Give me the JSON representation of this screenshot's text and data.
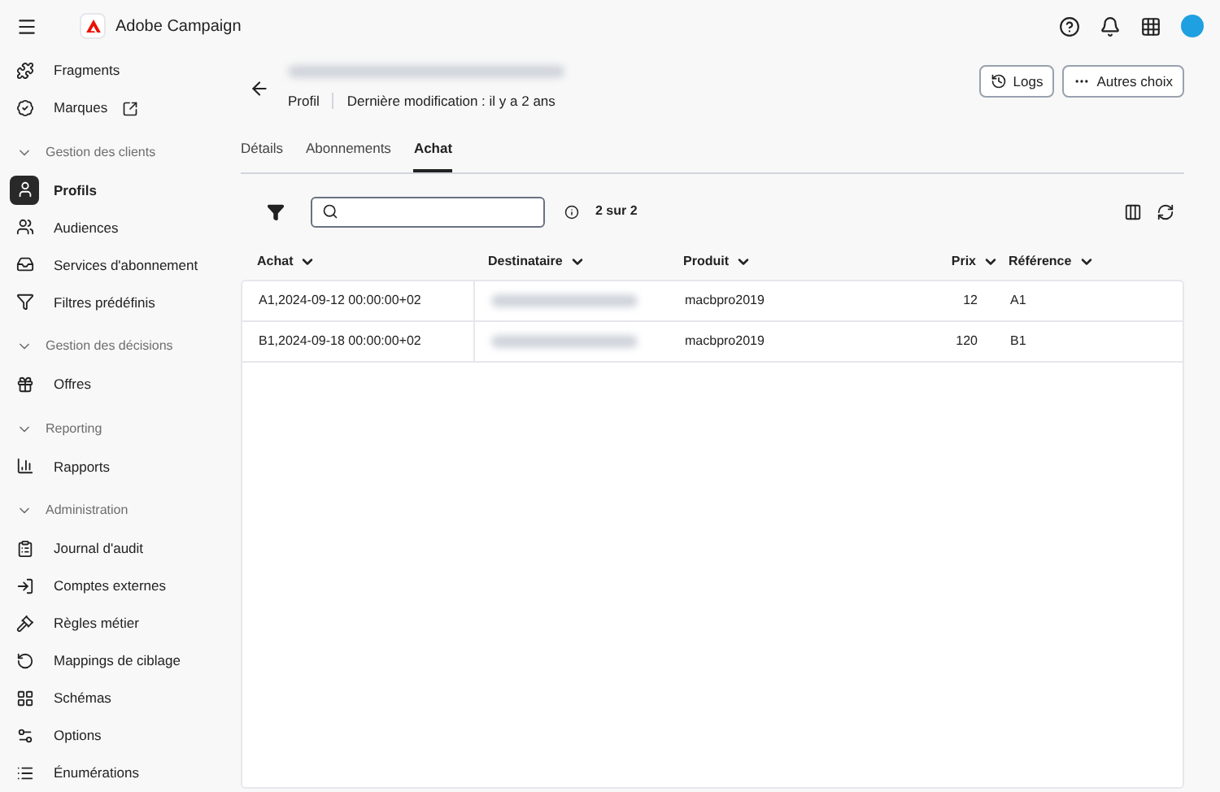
{
  "app": {
    "title": "Adobe Campaign"
  },
  "sidebar": {
    "items": [
      {
        "kind": "item",
        "label": "Fragments",
        "selected": false
      },
      {
        "kind": "item",
        "label": "Marques",
        "selected": false
      },
      {
        "kind": "section",
        "label": "Gestion des clients",
        "expanded": true
      },
      {
        "kind": "item",
        "label": "Profils",
        "selected": true
      },
      {
        "kind": "item",
        "label": "Audiences",
        "selected": false
      },
      {
        "kind": "item",
        "label": "Services d'abonnement",
        "selected": false
      },
      {
        "kind": "item",
        "label": "Filtres prédéfinis",
        "selected": false
      },
      {
        "kind": "section",
        "label": "Gestion des décisions",
        "expanded": true
      },
      {
        "kind": "item",
        "label": "Offres",
        "selected": false
      },
      {
        "kind": "section",
        "label": "Reporting",
        "expanded": true
      },
      {
        "kind": "item",
        "label": "Rapports",
        "selected": false
      },
      {
        "kind": "section",
        "label": "Administration",
        "expanded": true
      },
      {
        "kind": "item",
        "label": "Journal d'audit",
        "selected": false
      },
      {
        "kind": "item",
        "label": "Comptes externes",
        "selected": false
      },
      {
        "kind": "item",
        "label": "Règles métier",
        "selected": false
      },
      {
        "kind": "item",
        "label": "Mappings de ciblage",
        "selected": false
      },
      {
        "kind": "item",
        "label": "Schémas",
        "selected": false
      },
      {
        "kind": "item",
        "label": "Options",
        "selected": false
      },
      {
        "kind": "item",
        "label": "Énumérations",
        "selected": false
      }
    ]
  },
  "header": {
    "type": "Profil",
    "modified": "Dernière modification : il y a 2 ans",
    "buttons": [
      "Logs",
      "Autres choix"
    ]
  },
  "tabs": [
    {
      "label": "Détails",
      "selected": false
    },
    {
      "label": "Abonnements",
      "selected": false
    },
    {
      "label": "Achat",
      "selected": true
    }
  ],
  "toolbar": {
    "count": "2 sur 2"
  },
  "table": {
    "columns": [
      "Achat",
      "Destinataire",
      "Produit",
      "Prix",
      "Référence"
    ],
    "rows": [
      {
        "achat": "A1,2024-09-12 00:00:00+02",
        "produit": "macbpro2019",
        "prix": "12",
        "reference": "A1"
      },
      {
        "achat": "B1,2024-09-18 00:00:00+02",
        "produit": "macbpro2019",
        "prix": "120",
        "reference": "B1"
      }
    ]
  }
}
